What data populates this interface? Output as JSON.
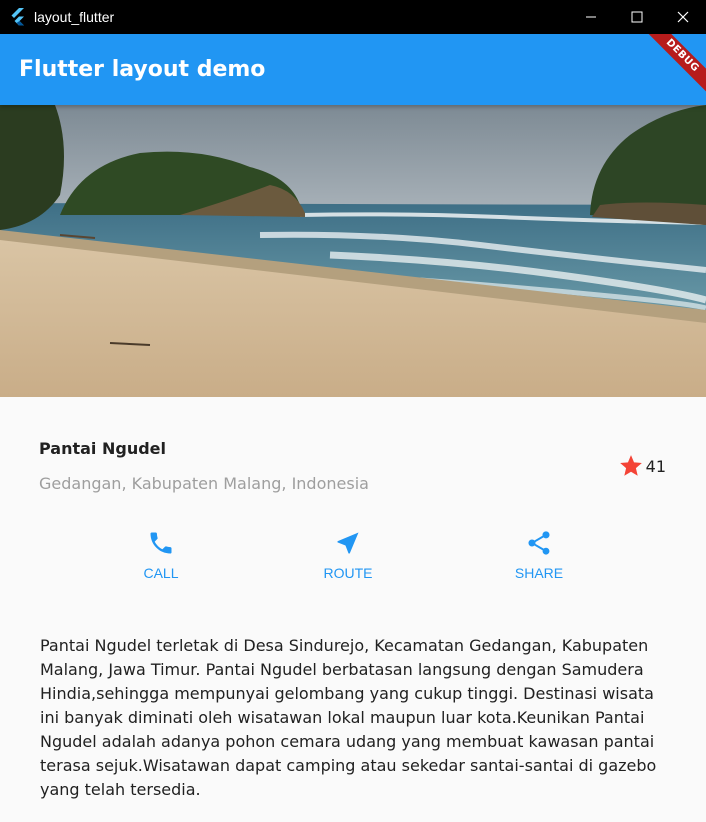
{
  "window": {
    "title": "layout_flutter"
  },
  "appbar": {
    "title": "Flutter layout demo",
    "debug_label": "DEBUG",
    "color": "#2196f3"
  },
  "place": {
    "name": "Pantai Ngudel",
    "location": "Gedangan, Kabupaten Malang, Indonesia",
    "rating_count": "41",
    "star_color": "#f44336"
  },
  "actions": [
    {
      "label": "CALL",
      "icon": "phone-icon"
    },
    {
      "label": "ROUTE",
      "icon": "near-me-icon"
    },
    {
      "label": "SHARE",
      "icon": "share-icon"
    }
  ],
  "description": "Pantai Ngudel terletak di Desa Sindurejo, Kecamatan Gedangan, Kabupaten Malang, Jawa Timur. Pantai Ngudel berbatasan langsung dengan Samudera Hindia,sehingga mempunyai gelombang yang cukup tinggi. Destinasi wisata ini banyak diminati oleh wisatawan lokal maupun luar kota.Keunikan Pantai Ngudel adalah adanya pohon cemara udang yang membuat kawasan pantai terasa sejuk.Wisatawan dapat camping atau sekedar santai-santai di gazebo yang telah tersedia."
}
